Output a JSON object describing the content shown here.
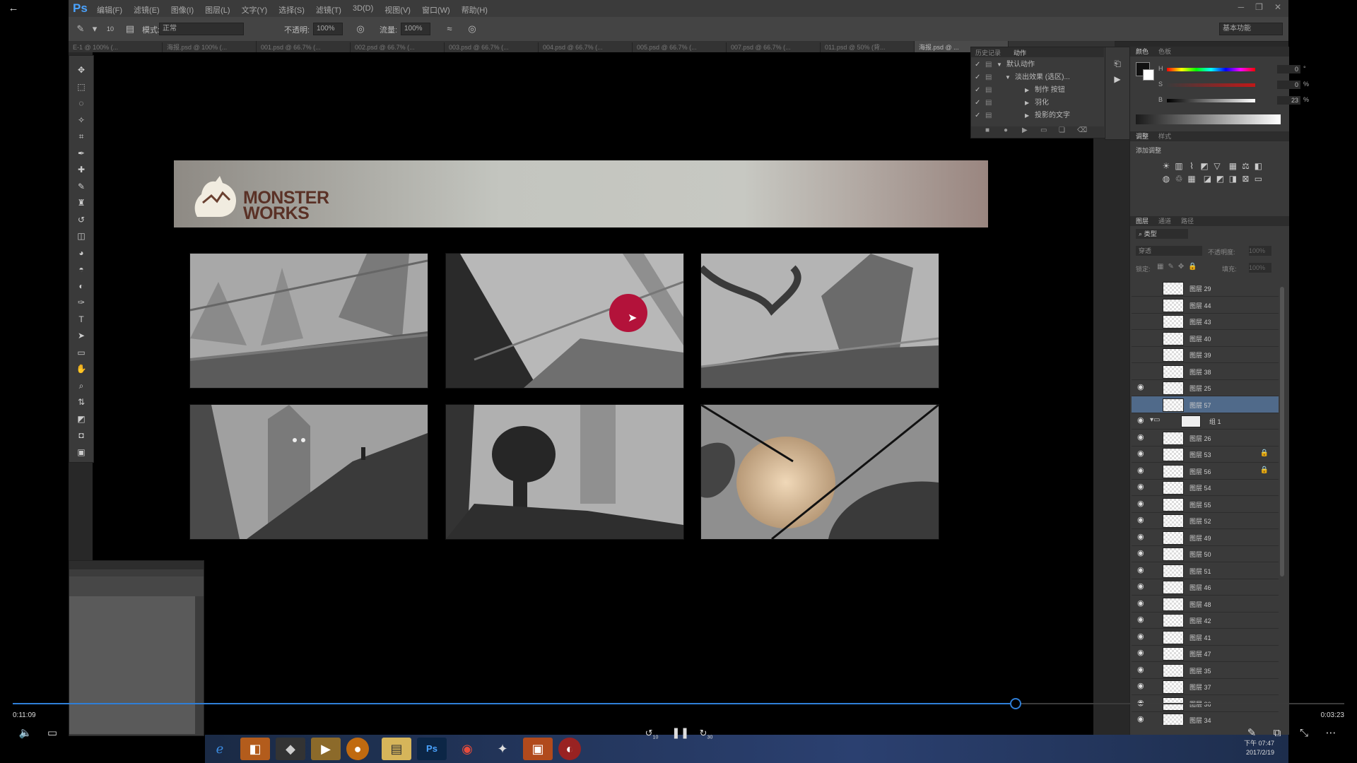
{
  "player": {
    "back_icon": "←",
    "elapsed": "0:11:09",
    "duration": "0:03:23",
    "progress": 0.7525,
    "skip_back_label": "10",
    "skip_forward_label": "30"
  },
  "ps": {
    "logo": "Ps",
    "menus": [
      "编辑(F)",
      "滤镜(E)",
      "图像(I)",
      "图层(L)",
      "文字(Y)",
      "选择(S)",
      "滤镜(T)",
      "3D(D)",
      "视图(V)",
      "窗口(W)",
      "帮助(H)"
    ],
    "options": {
      "brush_size": "10",
      "mode_label": "模式:",
      "mode_value": "正常",
      "opacity_label": "不透明:",
      "opacity_value": "100%",
      "flow_label": "流量:",
      "flow_value": "100%",
      "workspace": "基本功能"
    },
    "tabs": [
      "E-1 @ 100% (...",
      "海报.psd @ 100% (...",
      "001.psd @ 66.7% (...",
      "002.psd @ 66.7% (...",
      "003.psd @ 66.7% (...",
      "004.psd @ 66.7% (...",
      "005.psd @ 66.7% (...",
      "007.psd @ 66.7% (...",
      "011.psd @ 50% (背...",
      "海报.psd @ ..."
    ],
    "document": {
      "brand_line1": "MONSTER",
      "brand_line2": "WORKS"
    },
    "actions_panel": {
      "tabs": [
        "历史记录",
        "动作"
      ],
      "rows": [
        "默认动作",
        "淡出效果 (选区)...",
        "制作 按钮",
        "羽化",
        "投影的文字"
      ]
    },
    "color_panel": {
      "tabs": [
        "颜色",
        "色板"
      ],
      "h_label": "H",
      "h_value": "0",
      "s_label": "S",
      "s_value": "0",
      "b_label": "B",
      "b_value": "23",
      "unit": "%"
    },
    "adjustments": {
      "tabs": [
        "调整",
        "样式"
      ],
      "title": "添加调整"
    },
    "layers": {
      "tabs": [
        "图层",
        "通道",
        "路径"
      ],
      "kind_label": "类型",
      "blend_label": "穿透",
      "opacity_label": "不透明度:",
      "opacity_value": "100%",
      "lock_label": "锁定:",
      "fill_label": "填充:",
      "fill_value": "100%",
      "items": [
        {
          "name": "图层 29",
          "visible": false,
          "selected": false,
          "lock": false,
          "group": false
        },
        {
          "name": "图层 44",
          "visible": false,
          "selected": false,
          "lock": false,
          "group": false
        },
        {
          "name": "图层 43",
          "visible": false,
          "selected": false,
          "lock": false,
          "group": false
        },
        {
          "name": "图层 40",
          "visible": false,
          "selected": false,
          "lock": false,
          "group": false
        },
        {
          "name": "图层 39",
          "visible": false,
          "selected": false,
          "lock": false,
          "group": false
        },
        {
          "name": "图层 38",
          "visible": false,
          "selected": false,
          "lock": false,
          "group": false
        },
        {
          "name": "图层 25",
          "visible": true,
          "selected": false,
          "lock": false,
          "group": false
        },
        {
          "name": "图层 57",
          "visible": false,
          "selected": true,
          "lock": false,
          "group": false
        },
        {
          "name": "组 1",
          "visible": true,
          "selected": false,
          "lock": false,
          "group": true
        },
        {
          "name": "图层 26",
          "visible": true,
          "selected": false,
          "lock": false,
          "group": false
        },
        {
          "name": "图层 53",
          "visible": true,
          "selected": false,
          "lock": true,
          "group": false
        },
        {
          "name": "图层 56",
          "visible": true,
          "selected": false,
          "lock": true,
          "group": false
        },
        {
          "name": "图层 54",
          "visible": true,
          "selected": false,
          "lock": false,
          "group": false
        },
        {
          "name": "图层 55",
          "visible": true,
          "selected": false,
          "lock": false,
          "group": false
        },
        {
          "name": "图层 52",
          "visible": true,
          "selected": false,
          "lock": false,
          "group": false
        },
        {
          "name": "图层 49",
          "visible": true,
          "selected": false,
          "lock": false,
          "group": false
        },
        {
          "name": "图层 50",
          "visible": true,
          "selected": false,
          "lock": false,
          "group": false
        },
        {
          "name": "图层 51",
          "visible": true,
          "selected": false,
          "lock": false,
          "group": false
        },
        {
          "name": "图层 46",
          "visible": true,
          "selected": false,
          "lock": false,
          "group": false
        },
        {
          "name": "图层 48",
          "visible": true,
          "selected": false,
          "lock": false,
          "group": false
        },
        {
          "name": "图层 42",
          "visible": true,
          "selected": false,
          "lock": false,
          "group": false
        },
        {
          "name": "图层 41",
          "visible": true,
          "selected": false,
          "lock": false,
          "group": false
        },
        {
          "name": "图层 47",
          "visible": true,
          "selected": false,
          "lock": false,
          "group": false
        },
        {
          "name": "图层 35",
          "visible": true,
          "selected": false,
          "lock": false,
          "group": false
        },
        {
          "name": "图层 37",
          "visible": true,
          "selected": false,
          "lock": false,
          "group": false
        },
        {
          "name": "图层 36",
          "visible": true,
          "selected": false,
          "lock": false,
          "group": false
        },
        {
          "name": "图层 34",
          "visible": true,
          "selected": false,
          "lock": false,
          "group": false
        }
      ]
    }
  },
  "taskbar": {
    "clock_time": "下午 07:47",
    "clock_date": "2017/2/19"
  },
  "colors": {
    "accent": "#2f7fd8",
    "ps_blue": "#4aa3ff",
    "brand": "#5a3126",
    "cursor_red": "#b3123a",
    "layer_selected": "#506a8a"
  }
}
